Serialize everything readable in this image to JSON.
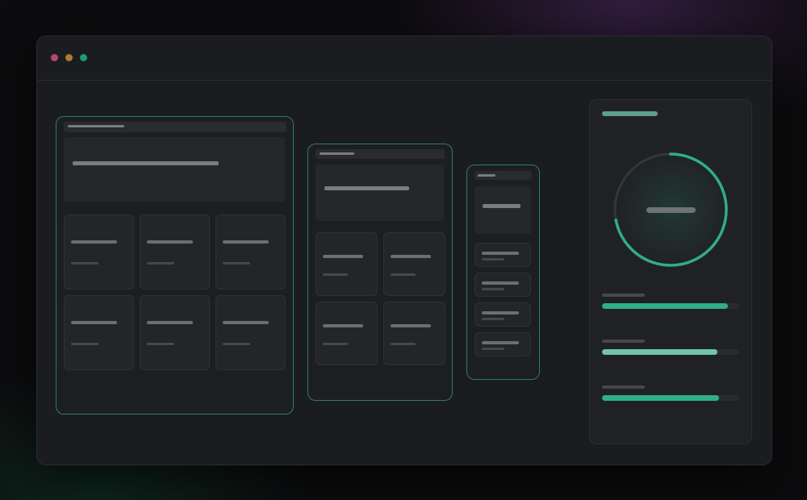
{
  "colors": {
    "accent": "#2fae88",
    "accent_soft": "#73c3a9",
    "frame_border": "#2f7c63",
    "window_bg": "#1b1c1f",
    "traffic_red": "#b04a6a",
    "traffic_yellow": "#b07a30",
    "traffic_green": "#179b7a"
  },
  "window": {
    "controls": [
      "close-dot",
      "minimize-dot",
      "maximize-dot"
    ]
  },
  "layouts": [
    {
      "name": "desktop",
      "columns": 3,
      "rows": 2
    },
    {
      "name": "tablet",
      "columns": 2,
      "rows": 2
    },
    {
      "name": "mobile",
      "columns": 1,
      "rows": 4
    }
  ],
  "stats_panel": {
    "gauge_value": 0.72,
    "progress": [
      {
        "value": 0.92,
        "color": "#2fae88"
      },
      {
        "value": 0.84,
        "color": "#73c3a9"
      },
      {
        "value": 0.85,
        "color": "#2fae88"
      }
    ]
  }
}
